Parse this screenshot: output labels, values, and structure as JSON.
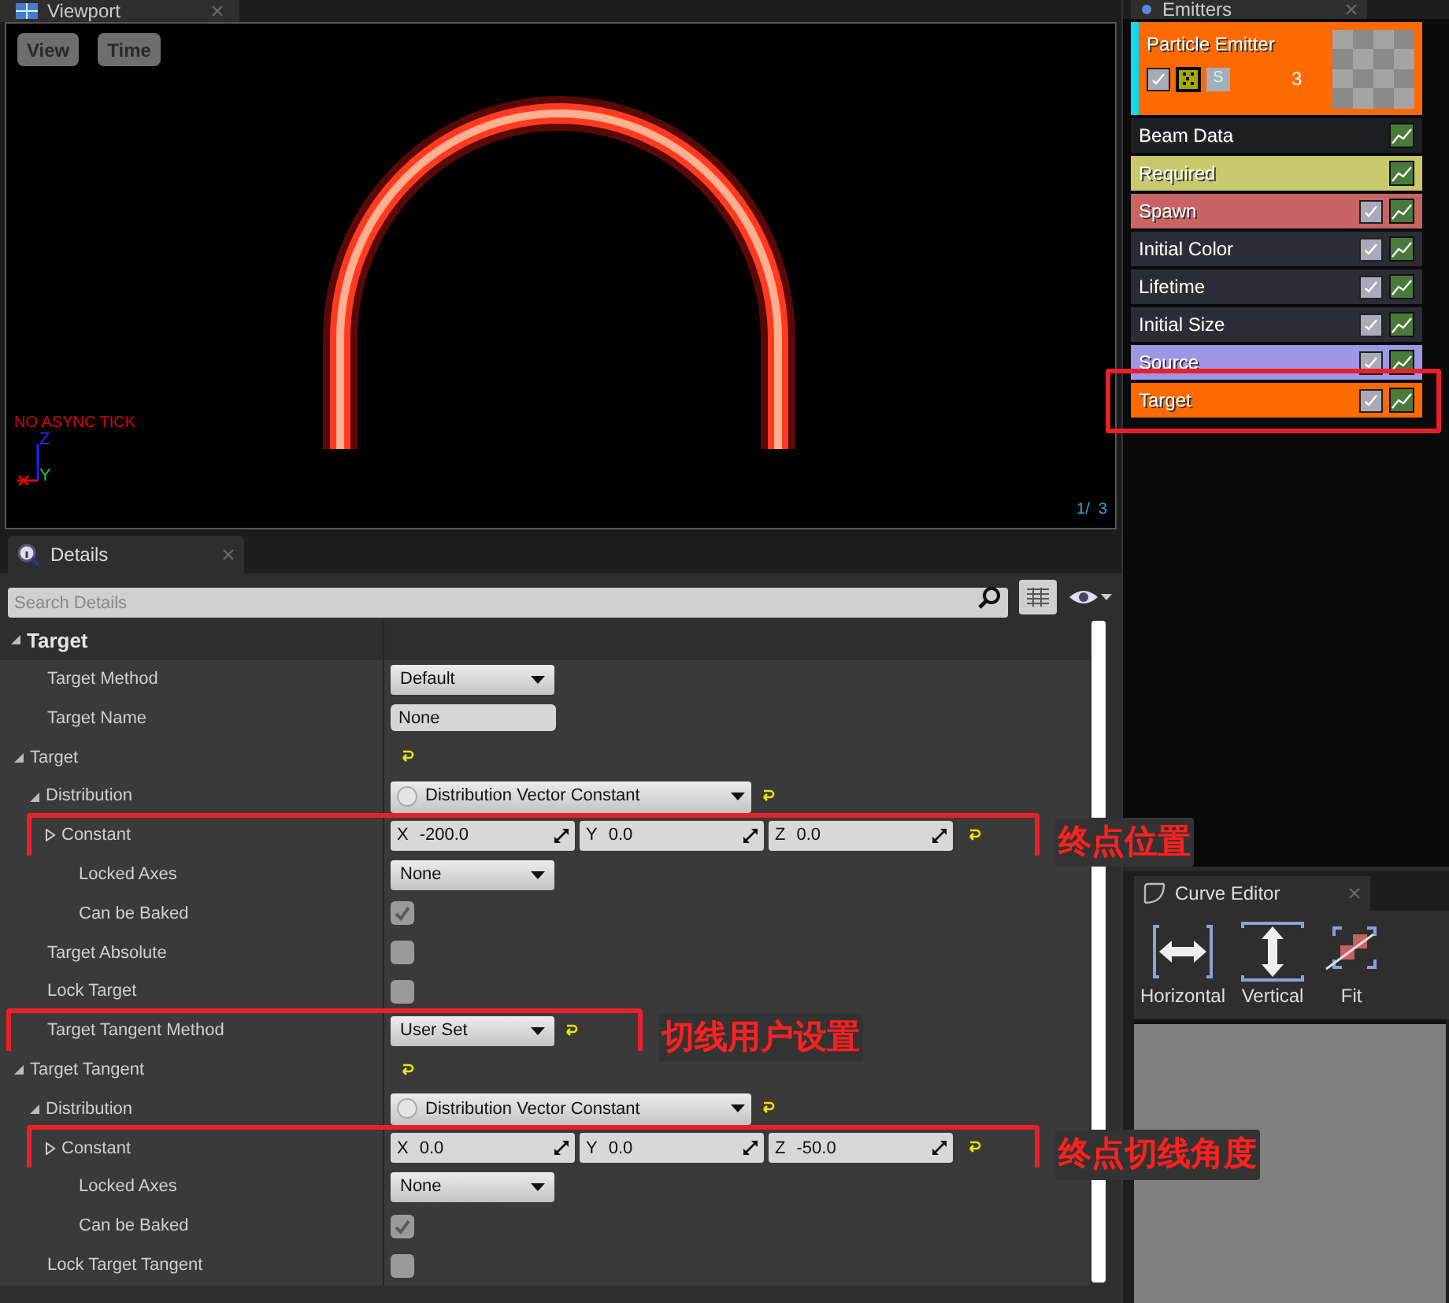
{
  "viewport": {
    "tab": "Viewport",
    "buttons": [
      "View",
      "Time"
    ],
    "overlay_text": "NO ASYNC TICK",
    "axes": [
      "Z",
      "Y"
    ],
    "counter": "1/  3"
  },
  "details": {
    "tab": "Details",
    "search": {
      "placeholder": "Search Details"
    },
    "rows": [
      {
        "kind": "header",
        "label": "Target",
        "expanded": true,
        "children": [
          {
            "kind": "dropdown",
            "label": "Target Method",
            "value": "Default"
          },
          {
            "kind": "text",
            "label": "Target Name",
            "value": "None"
          },
          {
            "kind": "group",
            "label": "Target",
            "expanded": true,
            "reset": true,
            "children": [
              {
                "kind": "distribution",
                "label": "Distribution",
                "expanded": true,
                "value": "Distribution Vector Constant",
                "reset": true,
                "children": [
                  {
                    "kind": "vector",
                    "label": "Constant",
                    "expanded": false,
                    "reset": true,
                    "annotation": "终点位置",
                    "values": [
                      {
                        "axis": "X",
                        "value": "-200.0"
                      },
                      {
                        "axis": "Y",
                        "value": "0.0"
                      },
                      {
                        "axis": "Z",
                        "value": "0.0"
                      }
                    ]
                  },
                  {
                    "kind": "dropdown",
                    "label": "Locked Axes",
                    "value": "None"
                  },
                  {
                    "kind": "checkbox",
                    "label": "Can be Baked",
                    "checked": true
                  }
                ]
              }
            ]
          },
          {
            "kind": "checkbox",
            "label": "Target Absolute",
            "checked": false
          },
          {
            "kind": "checkbox",
            "label": "Lock Target",
            "checked": false
          },
          {
            "kind": "dropdown",
            "label": "Target Tangent Method",
            "value": "User Set",
            "reset": true,
            "annotation": "切线用户设置"
          },
          {
            "kind": "group",
            "label": "Target Tangent",
            "expanded": true,
            "reset": true,
            "children": [
              {
                "kind": "distribution",
                "label": "Distribution",
                "expanded": true,
                "value": "Distribution Vector Constant",
                "reset": true,
                "children": [
                  {
                    "kind": "vector",
                    "label": "Constant",
                    "expanded": false,
                    "reset": true,
                    "annotation": "终点切线角度",
                    "values": [
                      {
                        "axis": "X",
                        "value": "0.0"
                      },
                      {
                        "axis": "Y",
                        "value": "0.0"
                      },
                      {
                        "axis": "Z",
                        "value": "-50.0"
                      }
                    ]
                  },
                  {
                    "kind": "dropdown",
                    "label": "Locked Axes",
                    "value": "None"
                  },
                  {
                    "kind": "checkbox",
                    "label": "Can be Baked",
                    "checked": true
                  }
                ]
              }
            ]
          },
          {
            "kind": "checkbox",
            "label": "Lock Target Tangent",
            "checked": false
          }
        ]
      }
    ]
  },
  "emitters": {
    "tab": "Emitters",
    "emitter": {
      "name": "Particle Emitter",
      "enabled": true,
      "solo_label": "S",
      "count": "3"
    },
    "modules": [
      {
        "label": "Beam Data",
        "color": "#1e1f22",
        "toggle": false,
        "highlight_box": false
      },
      {
        "label": "Required",
        "color": "#c8c86c",
        "toggle": false,
        "highlight_box": false
      },
      {
        "label": "Spawn",
        "color": "#c86464",
        "toggle": true,
        "checked": true,
        "highlight_box": false
      },
      {
        "label": "Initial Color",
        "color": "#2b2c35",
        "toggle": true,
        "checked": true,
        "highlight_box": false
      },
      {
        "label": "Lifetime",
        "color": "#2b2c35",
        "toggle": true,
        "checked": true,
        "highlight_box": false
      },
      {
        "label": "Initial Size",
        "color": "#2b2c35",
        "toggle": true,
        "checked": true,
        "highlight_box": false
      },
      {
        "label": "Source",
        "color": "#a096e6",
        "toggle": true,
        "checked": true,
        "highlight_box": false
      },
      {
        "label": "Target",
        "color": "#ff6a00",
        "toggle": true,
        "checked": true,
        "highlight_box": true
      }
    ]
  },
  "curve_editor": {
    "tab": "Curve Editor",
    "tools": [
      {
        "kind": "horizontal",
        "label": "Horizontal"
      },
      {
        "kind": "vertical",
        "label": "Vertical"
      },
      {
        "kind": "fit",
        "label": "Fit"
      }
    ]
  }
}
